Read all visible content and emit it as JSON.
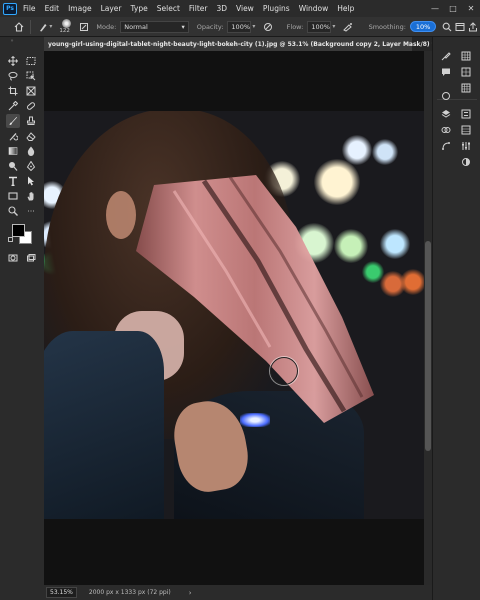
{
  "menubar": {
    "app_logo": "Ps",
    "items": [
      "File",
      "Edit",
      "Image",
      "Layer",
      "Type",
      "Select",
      "Filter",
      "3D",
      "View",
      "Plugins",
      "Window",
      "Help"
    ],
    "window_controls": [
      "—",
      "□",
      "✕"
    ]
  },
  "options": {
    "brush_size": "122",
    "mode_label": "Mode:",
    "mode_value": "Normal",
    "opacity_label": "Opacity:",
    "opacity_value": "100%",
    "flow_label": "Flow:",
    "flow_value": "100%",
    "smoothing_label": "Smoothing:",
    "smoothing_value": "10%"
  },
  "document": {
    "tab_title": "young-girl-using-digital-tablet-night-beauty-light-bokeh-city (1).jpg @ 53.1% (Background copy 2, Layer Mask/8) *",
    "close": "×"
  },
  "status": {
    "zoom": "53.15%",
    "info": "2000 px x 1333 px (72 ppi)",
    "arrow": "›"
  },
  "colors": {
    "accent": "#31a8ff",
    "smoothing_bg": "#1a6fd6",
    "ui_dark": "#2b2b2b",
    "canvas_bg": "#111111",
    "foreground_swatch": "#000000",
    "background_swatch": "#ffffff"
  },
  "toolbar_tools": [
    "move-icon",
    "marquee-icon",
    "lasso-icon",
    "object-select-icon",
    "crop-icon",
    "frame-icon",
    "eyedropper-icon",
    "spot-heal-icon",
    "brush-icon",
    "clone-stamp-icon",
    "history-brush-icon",
    "eraser-icon",
    "gradient-icon",
    "blur-icon",
    "dodge-icon",
    "pen-icon",
    "type-icon",
    "path-select-icon",
    "rectangle-icon",
    "hand-icon",
    "zoom-icon",
    "more-tools-icon",
    "color-swatches",
    "quick-mask-icon",
    "screen-mode-icon"
  ],
  "right_panel_icons": [
    "color-panel-icon",
    "swatches-panel-icon",
    "comment-icon",
    "learn-icon",
    "layers-panel-icon",
    "channels-panel-icon",
    "paths-panel-icon",
    "properties-panel-icon",
    "adjustments-icon",
    "libraries-icon",
    "styles-icon"
  ]
}
